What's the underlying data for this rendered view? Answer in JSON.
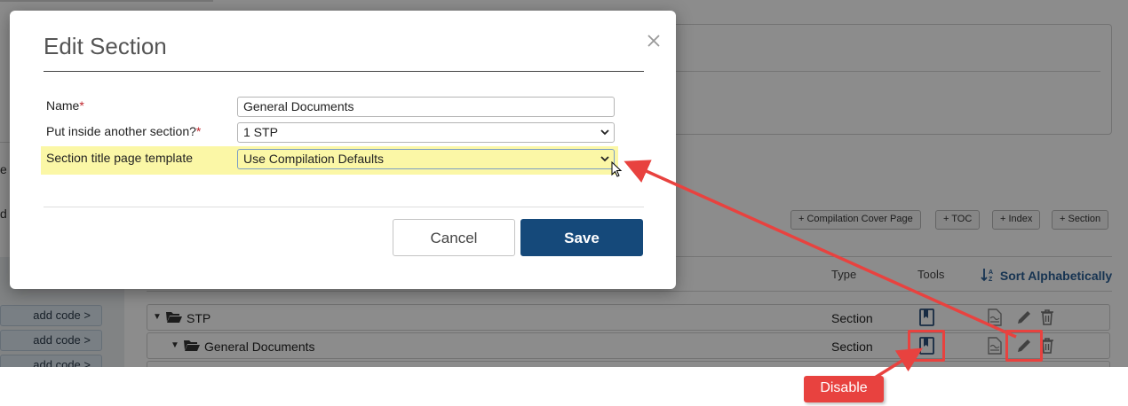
{
  "background": {
    "left_fragments": [
      "e",
      "d"
    ],
    "add_code_label": "add code >",
    "pills": [
      "+ Compilation Cover Page",
      "+ TOC",
      "+ Index",
      "+ Section"
    ],
    "columns": {
      "type": "Type",
      "tools": "Tools"
    },
    "sort_label": "Sort Alphabetically",
    "tree": [
      {
        "name": "STP",
        "type": "Section"
      },
      {
        "name": "General Documents",
        "type": "Section"
      }
    ]
  },
  "modal": {
    "title": "Edit Section",
    "name_label": "Name",
    "name_value": "General Documents",
    "parent_label": "Put inside another section?",
    "parent_value": "1 STP",
    "template_label": "Section title page template",
    "template_value": "Use Compilation Defaults",
    "required_mark": "*",
    "cancel_label": "Cancel",
    "save_label": "Save"
  },
  "annotation": {
    "label": "Disable",
    "color": "#e8423f"
  },
  "colors": {
    "primary": "#15497a",
    "highlight": "#fbf7a6",
    "link": "#2b5f95"
  }
}
